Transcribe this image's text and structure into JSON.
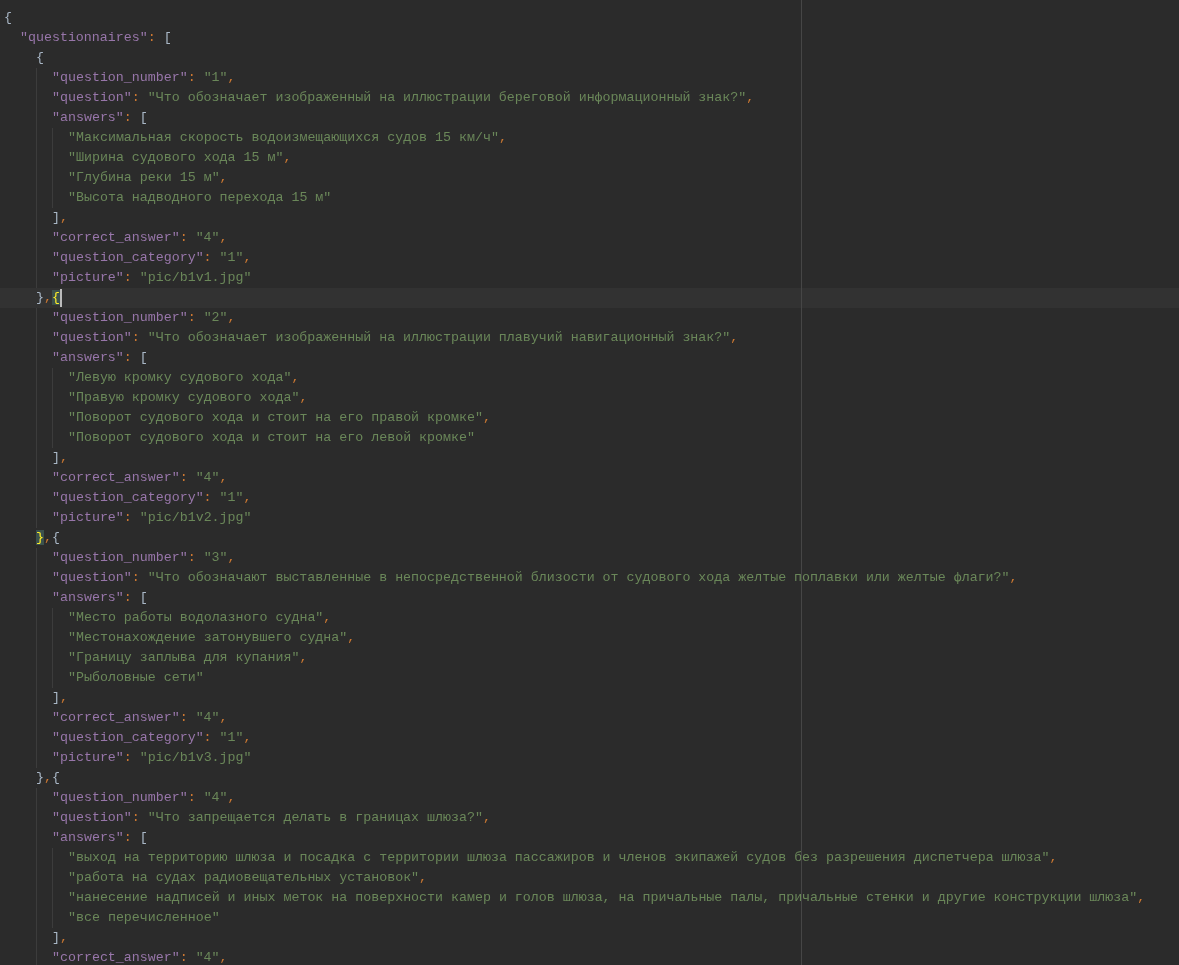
{
  "editor": {
    "lines": [
      {
        "current": false,
        "tokens": [
          {
            "kind": "brace",
            "text": "{"
          }
        ],
        "children": [
          {
            "current": false,
            "tokens": [
              {
                "kind": "key",
                "text": "\"questionnaires\""
              },
              {
                "kind": "punct",
                "text": ": "
              },
              {
                "kind": "brace",
                "text": "["
              }
            ],
            "children": [
              {
                "current": false,
                "tokens": [
                  {
                    "kind": "brace",
                    "text": "{"
                  }
                ],
                "children": [
                  {
                    "current": false,
                    "tokens": [
                      {
                        "kind": "key",
                        "text": "\"question_number\""
                      },
                      {
                        "kind": "punct",
                        "text": ": "
                      },
                      {
                        "kind": "string",
                        "text": "\"1\""
                      },
                      {
                        "kind": "punct",
                        "text": ","
                      }
                    ]
                  },
                  {
                    "current": false,
                    "tokens": [
                      {
                        "kind": "key",
                        "text": "\"question\""
                      },
                      {
                        "kind": "punct",
                        "text": ": "
                      },
                      {
                        "kind": "string",
                        "text": "\"Что обозначает изображенный на иллюстрации береговой информационный знак?\""
                      },
                      {
                        "kind": "punct",
                        "text": ","
                      }
                    ]
                  },
                  {
                    "current": false,
                    "tokens": [
                      {
                        "kind": "key",
                        "text": "\"answers\""
                      },
                      {
                        "kind": "punct",
                        "text": ": "
                      },
                      {
                        "kind": "brace",
                        "text": "["
                      }
                    ],
                    "children": [
                      {
                        "current": false,
                        "tokens": [
                          {
                            "kind": "string",
                            "text": "\"Максимальная скорость водоизмещающихся судов 15 км/ч\""
                          },
                          {
                            "kind": "punct",
                            "text": ","
                          }
                        ]
                      },
                      {
                        "current": false,
                        "tokens": [
                          {
                            "kind": "string",
                            "text": "\"Ширина судового хода 15 м\""
                          },
                          {
                            "kind": "punct",
                            "text": ","
                          }
                        ]
                      },
                      {
                        "current": false,
                        "tokens": [
                          {
                            "kind": "string",
                            "text": "\"Глубина реки 15 м\""
                          },
                          {
                            "kind": "punct",
                            "text": ","
                          }
                        ]
                      },
                      {
                        "current": false,
                        "tokens": [
                          {
                            "kind": "string",
                            "text": "\"Высота надводного перехода 15 м\""
                          }
                        ]
                      }
                    ]
                  },
                  {
                    "current": false,
                    "tokens": [
                      {
                        "kind": "brace",
                        "text": "]"
                      },
                      {
                        "kind": "punct",
                        "text": ","
                      }
                    ]
                  },
                  {
                    "current": false,
                    "tokens": [
                      {
                        "kind": "key",
                        "text": "\"correct_answer\""
                      },
                      {
                        "kind": "punct",
                        "text": ": "
                      },
                      {
                        "kind": "string",
                        "text": "\"4\""
                      },
                      {
                        "kind": "punct",
                        "text": ","
                      }
                    ]
                  },
                  {
                    "current": false,
                    "tokens": [
                      {
                        "kind": "key",
                        "text": "\"question_category\""
                      },
                      {
                        "kind": "punct",
                        "text": ": "
                      },
                      {
                        "kind": "string",
                        "text": "\"1\""
                      },
                      {
                        "kind": "punct",
                        "text": ","
                      }
                    ]
                  },
                  {
                    "current": false,
                    "tokens": [
                      {
                        "kind": "key",
                        "text": "\"picture\""
                      },
                      {
                        "kind": "punct",
                        "text": ": "
                      },
                      {
                        "kind": "string",
                        "text": "\"pic/b1v1.jpg\""
                      }
                    ]
                  }
                ]
              },
              {
                "current": true,
                "tokens": [
                  {
                    "kind": "brace",
                    "text": "}"
                  },
                  {
                    "kind": "punct",
                    "text": ","
                  },
                  {
                    "kind": "brace-match",
                    "text": "{"
                  }
                ],
                "children": [
                  {
                    "current": false,
                    "tokens": [
                      {
                        "kind": "key",
                        "text": "\"question_number\""
                      },
                      {
                        "kind": "punct",
                        "text": ": "
                      },
                      {
                        "kind": "string",
                        "text": "\"2\""
                      },
                      {
                        "kind": "punct",
                        "text": ","
                      }
                    ]
                  },
                  {
                    "current": false,
                    "tokens": [
                      {
                        "kind": "key",
                        "text": "\"question\""
                      },
                      {
                        "kind": "punct",
                        "text": ": "
                      },
                      {
                        "kind": "string",
                        "text": "\"Что обозначает изображенный на иллюстрации плавучий навигационный знак?\""
                      },
                      {
                        "kind": "punct",
                        "text": ","
                      }
                    ]
                  },
                  {
                    "current": false,
                    "tokens": [
                      {
                        "kind": "key",
                        "text": "\"answers\""
                      },
                      {
                        "kind": "punct",
                        "text": ": "
                      },
                      {
                        "kind": "brace",
                        "text": "["
                      }
                    ],
                    "children": [
                      {
                        "current": false,
                        "tokens": [
                          {
                            "kind": "string",
                            "text": "\"Левую кромку судового хода\""
                          },
                          {
                            "kind": "punct",
                            "text": ","
                          }
                        ]
                      },
                      {
                        "current": false,
                        "tokens": [
                          {
                            "kind": "string",
                            "text": "\"Правую кромку судового хода\""
                          },
                          {
                            "kind": "punct",
                            "text": ","
                          }
                        ]
                      },
                      {
                        "current": false,
                        "tokens": [
                          {
                            "kind": "string",
                            "text": "\"Поворот судового хода и стоит на его правой кромке\""
                          },
                          {
                            "kind": "punct",
                            "text": ","
                          }
                        ]
                      },
                      {
                        "current": false,
                        "tokens": [
                          {
                            "kind": "string",
                            "text": "\"Поворот судового хода и стоит на его левой кромке\""
                          }
                        ]
                      }
                    ]
                  },
                  {
                    "current": false,
                    "tokens": [
                      {
                        "kind": "brace",
                        "text": "]"
                      },
                      {
                        "kind": "punct",
                        "text": ","
                      }
                    ]
                  },
                  {
                    "current": false,
                    "tokens": [
                      {
                        "kind": "key",
                        "text": "\"correct_answer\""
                      },
                      {
                        "kind": "punct",
                        "text": ": "
                      },
                      {
                        "kind": "string",
                        "text": "\"4\""
                      },
                      {
                        "kind": "punct",
                        "text": ","
                      }
                    ]
                  },
                  {
                    "current": false,
                    "tokens": [
                      {
                        "kind": "key",
                        "text": "\"question_category\""
                      },
                      {
                        "kind": "punct",
                        "text": ": "
                      },
                      {
                        "kind": "string",
                        "text": "\"1\""
                      },
                      {
                        "kind": "punct",
                        "text": ","
                      }
                    ]
                  },
                  {
                    "current": false,
                    "tokens": [
                      {
                        "kind": "key",
                        "text": "\"picture\""
                      },
                      {
                        "kind": "punct",
                        "text": ": "
                      },
                      {
                        "kind": "string",
                        "text": "\"pic/b1v2.jpg\""
                      }
                    ]
                  }
                ]
              },
              {
                "current": false,
                "tokens": [
                  {
                    "kind": "brace-match",
                    "text": "}"
                  },
                  {
                    "kind": "punct",
                    "text": ","
                  },
                  {
                    "kind": "brace",
                    "text": "{"
                  }
                ],
                "children": [
                  {
                    "current": false,
                    "tokens": [
                      {
                        "kind": "key",
                        "text": "\"question_number\""
                      },
                      {
                        "kind": "punct",
                        "text": ": "
                      },
                      {
                        "kind": "string",
                        "text": "\"3\""
                      },
                      {
                        "kind": "punct",
                        "text": ","
                      }
                    ]
                  },
                  {
                    "current": false,
                    "tokens": [
                      {
                        "kind": "key",
                        "text": "\"question\""
                      },
                      {
                        "kind": "punct",
                        "text": ": "
                      },
                      {
                        "kind": "string",
                        "text": "\"Что обозначают выставленные в непосредственной близости от судового хода желтые поплавки или желтые флаги?\""
                      },
                      {
                        "kind": "punct",
                        "text": ","
                      }
                    ]
                  },
                  {
                    "current": false,
                    "tokens": [
                      {
                        "kind": "key",
                        "text": "\"answers\""
                      },
                      {
                        "kind": "punct",
                        "text": ": "
                      },
                      {
                        "kind": "brace",
                        "text": "["
                      }
                    ],
                    "children": [
                      {
                        "current": false,
                        "tokens": [
                          {
                            "kind": "string",
                            "text": "\"Место работы водолазного судна\""
                          },
                          {
                            "kind": "punct",
                            "text": ","
                          }
                        ]
                      },
                      {
                        "current": false,
                        "tokens": [
                          {
                            "kind": "string",
                            "text": "\"Местонахождение затонувшего судна\""
                          },
                          {
                            "kind": "punct",
                            "text": ","
                          }
                        ]
                      },
                      {
                        "current": false,
                        "tokens": [
                          {
                            "kind": "string",
                            "text": "\"Границу заплыва для купания\""
                          },
                          {
                            "kind": "punct",
                            "text": ","
                          }
                        ]
                      },
                      {
                        "current": false,
                        "tokens": [
                          {
                            "kind": "string",
                            "text": "\"Рыболовные сети\""
                          }
                        ]
                      }
                    ]
                  },
                  {
                    "current": false,
                    "tokens": [
                      {
                        "kind": "brace",
                        "text": "]"
                      },
                      {
                        "kind": "punct",
                        "text": ","
                      }
                    ]
                  },
                  {
                    "current": false,
                    "tokens": [
                      {
                        "kind": "key",
                        "text": "\"correct_answer\""
                      },
                      {
                        "kind": "punct",
                        "text": ": "
                      },
                      {
                        "kind": "string",
                        "text": "\"4\""
                      },
                      {
                        "kind": "punct",
                        "text": ","
                      }
                    ]
                  },
                  {
                    "current": false,
                    "tokens": [
                      {
                        "kind": "key",
                        "text": "\"question_category\""
                      },
                      {
                        "kind": "punct",
                        "text": ": "
                      },
                      {
                        "kind": "string",
                        "text": "\"1\""
                      },
                      {
                        "kind": "punct",
                        "text": ","
                      }
                    ]
                  },
                  {
                    "current": false,
                    "tokens": [
                      {
                        "kind": "key",
                        "text": "\"picture\""
                      },
                      {
                        "kind": "punct",
                        "text": ": "
                      },
                      {
                        "kind": "string",
                        "text": "\"pic/b1v3.jpg\""
                      }
                    ]
                  }
                ]
              },
              {
                "current": false,
                "tokens": [
                  {
                    "kind": "brace",
                    "text": "}"
                  },
                  {
                    "kind": "punct",
                    "text": ","
                  },
                  {
                    "kind": "brace",
                    "text": "{"
                  }
                ],
                "children": [
                  {
                    "current": false,
                    "tokens": [
                      {
                        "kind": "key",
                        "text": "\"question_number\""
                      },
                      {
                        "kind": "punct",
                        "text": ": "
                      },
                      {
                        "kind": "string",
                        "text": "\"4\""
                      },
                      {
                        "kind": "punct",
                        "text": ","
                      }
                    ]
                  },
                  {
                    "current": false,
                    "tokens": [
                      {
                        "kind": "key",
                        "text": "\"question\""
                      },
                      {
                        "kind": "punct",
                        "text": ": "
                      },
                      {
                        "kind": "string",
                        "text": "\"Что запрещается делать в границах шлюза?\""
                      },
                      {
                        "kind": "punct",
                        "text": ","
                      }
                    ]
                  },
                  {
                    "current": false,
                    "tokens": [
                      {
                        "kind": "key",
                        "text": "\"answers\""
                      },
                      {
                        "kind": "punct",
                        "text": ": "
                      },
                      {
                        "kind": "brace",
                        "text": "["
                      }
                    ],
                    "children": [
                      {
                        "current": false,
                        "tokens": [
                          {
                            "kind": "string",
                            "text": "\"выход на территорию шлюза и посадка с территории шлюза пассажиров и членов экипажей судов без разрешения диспетчера шлюза\""
                          },
                          {
                            "kind": "punct",
                            "text": ","
                          }
                        ]
                      },
                      {
                        "current": false,
                        "tokens": [
                          {
                            "kind": "string",
                            "text": "\"работа на судах радиовещательных установок\""
                          },
                          {
                            "kind": "punct",
                            "text": ","
                          }
                        ]
                      },
                      {
                        "current": false,
                        "tokens": [
                          {
                            "kind": "string",
                            "text": "\"нанесение надписей и иных меток на поверхности камер и голов шлюза, на причальные палы, причальные стенки и другие конструкции шлюза\""
                          },
                          {
                            "kind": "punct",
                            "text": ","
                          }
                        ]
                      },
                      {
                        "current": false,
                        "tokens": [
                          {
                            "kind": "string",
                            "text": "\"все перечисленное\""
                          }
                        ]
                      }
                    ]
                  },
                  {
                    "current": false,
                    "tokens": [
                      {
                        "kind": "brace",
                        "text": "]"
                      },
                      {
                        "kind": "punct",
                        "text": ","
                      }
                    ]
                  },
                  {
                    "current": false,
                    "tokens": [
                      {
                        "kind": "key",
                        "text": "\"correct_answer\""
                      },
                      {
                        "kind": "punct",
                        "text": ": "
                      },
                      {
                        "kind": "string",
                        "text": "\"4\""
                      },
                      {
                        "kind": "punct",
                        "text": ","
                      }
                    ]
                  }
                ]
              }
            ]
          }
        ]
      }
    ]
  }
}
